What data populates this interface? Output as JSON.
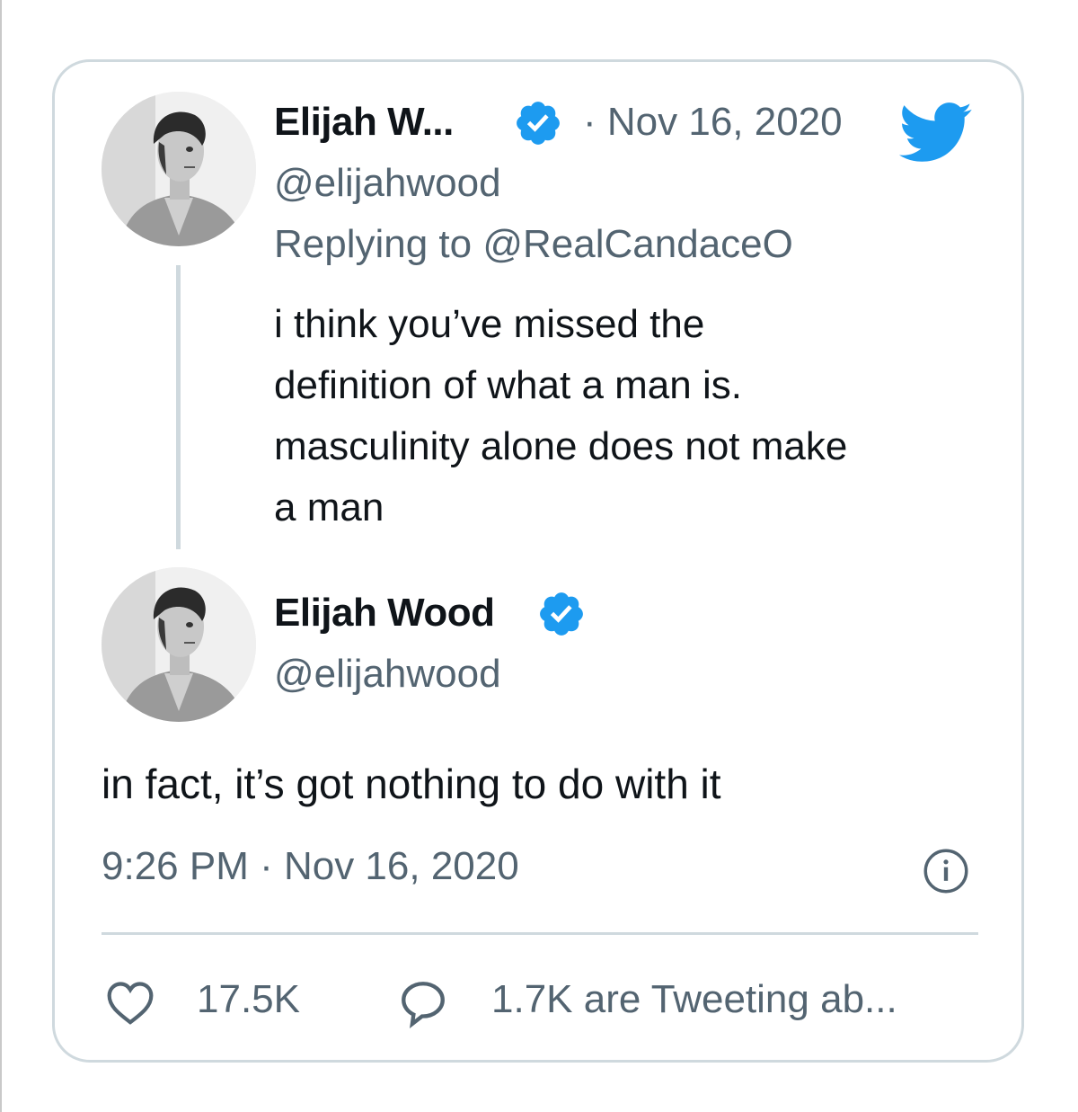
{
  "reply_tweet": {
    "author_name": "Elijah W...",
    "separator_date": "· Nov 16, 2020",
    "handle": "@elijahwood",
    "replying_to": "Replying to @RealCandaceO",
    "text_lines": [
      "i think you’ve missed the",
      "definition of what a man is.",
      "masculinity alone does not make",
      "a man"
    ]
  },
  "main_tweet": {
    "author_name": "Elijah Wood",
    "handle": "@elijahwood",
    "text": "in fact, it’s got nothing to do with it",
    "timestamp": "9:26 PM · Nov 16, 2020"
  },
  "actions": {
    "likes": "17.5K",
    "replies_label": "1.7K are Tweeting ab..."
  },
  "icons": {
    "brand": "twitter-bird-icon",
    "verified": "verified-badge-icon",
    "info": "info-icon",
    "like": "heart-icon",
    "reply": "comment-bubble-icon"
  },
  "colors": {
    "twitter_blue": "#1d9bf0",
    "text_primary": "#0f1419",
    "text_secondary": "#536471",
    "border": "#cfd9de"
  }
}
